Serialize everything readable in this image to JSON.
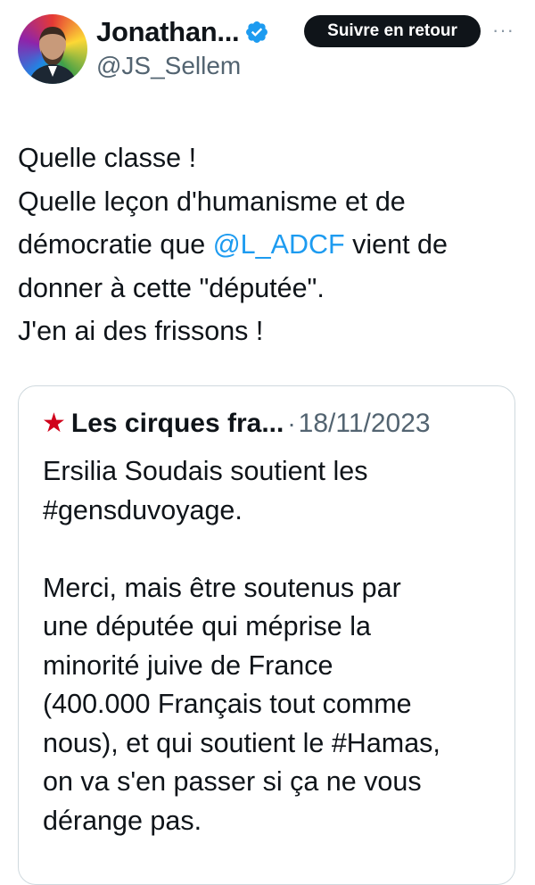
{
  "author": {
    "display_name": "Jonathan...",
    "handle": "@JS_Sellem",
    "avatar_icon": "profile-photo",
    "verified_icon": "verified-badge-icon"
  },
  "actions": {
    "follow_label": "Suivre en retour",
    "more_icon": "more-icon"
  },
  "tweet": {
    "lines": [
      {
        "text": "Quelle classe !"
      },
      {
        "text": "Quelle leçon d'humanisme et de"
      },
      {
        "before": "démocratie que ",
        "mention": "@L_ADCF",
        "after": " vient de"
      },
      {
        "text": "donner à cette \"députée\"."
      },
      {
        "text": "J'en ai des frissons !"
      }
    ]
  },
  "quote": {
    "star_icon": "red-star-icon",
    "display_name": "Les cirques fra...",
    "separator": "·",
    "date": "18/11/2023",
    "lines": [
      "Ersilia Soudais soutient les",
      "#gensduvoyage.",
      "",
      "Merci, mais être soutenus par",
      "une députée qui méprise la",
      "minorité juive de France",
      "(400.000 Français tout comme",
      "nous), et qui soutient le #Hamas,",
      "on va s'en passer si ça ne vous",
      "dérange pas."
    ]
  },
  "colors": {
    "link": "#1d9bf0",
    "secondary_text": "#536471",
    "button_bg": "#0f1419",
    "star": "#d0021b",
    "border": "#cfd9de"
  }
}
